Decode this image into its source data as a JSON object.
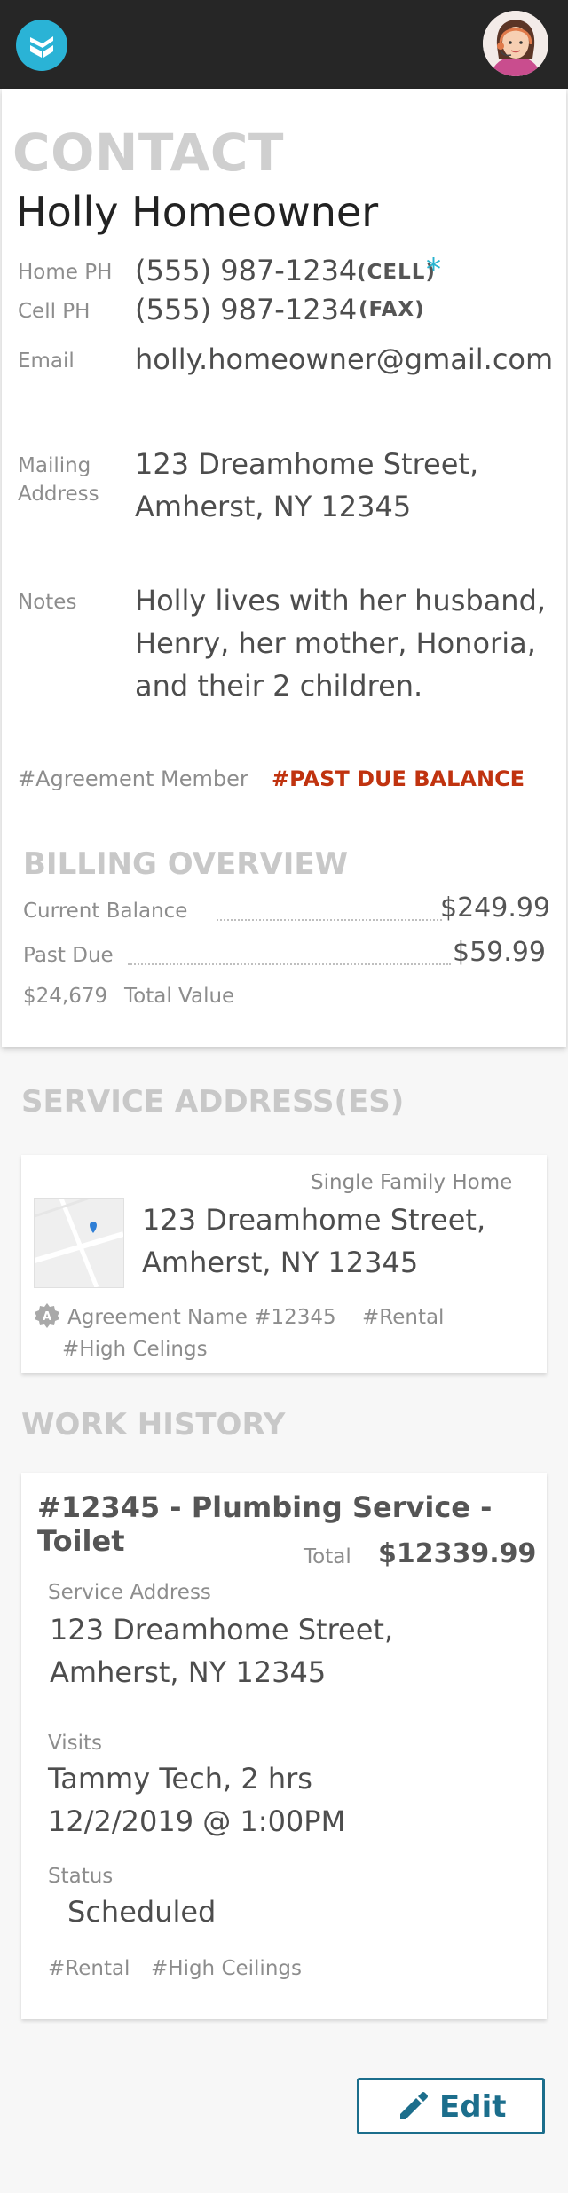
{
  "contact": {
    "heading": "CONTACT",
    "name": "Holly Homeowner",
    "phones": [
      {
        "label": "Home PH",
        "number": "(555) 987-1234",
        "tag": "(CELL)",
        "marker": "*"
      },
      {
        "label": "Cell PH",
        "number": "(555) 987-1234",
        "tag": "(FAX)"
      }
    ],
    "email_label": "Email",
    "email": "holly.homeowner@gmail.com",
    "mailing_label_1": "Mailing",
    "mailing_label_2": "Address",
    "mailing_line1": "123 Dreamhome Street,",
    "mailing_line2": "Amherst, NY 12345",
    "notes_label": "Notes",
    "notes_line1": "Holly lives with her husband,",
    "notes_line2": "Henry, her mother, Honoria,",
    "notes_line3": "and their 2 children.",
    "tags": [
      "#Agreement Member",
      "#PAST DUE BALANCE"
    ]
  },
  "billing": {
    "heading": "BILLING OVERVIEW",
    "current_label": "Current Balance",
    "current_value": "$249.99",
    "past_due_label": "Past Due",
    "past_due_value": "$59.99",
    "total_amount": "$24,679",
    "total_label": "Total Value"
  },
  "service": {
    "heading": "SERVICE ADDRESS(ES)",
    "type": "Single Family Home",
    "line1": "123 Dreamhome Street,",
    "line2": "Amherst, NY 12345",
    "agreement": "Agreement Name #12345",
    "tags": [
      "#Rental",
      "#High Celings"
    ]
  },
  "work": {
    "heading": "WORK HISTORY",
    "job_title": "#12345 - Plumbing Service - Toilet",
    "total_label": "Total",
    "total_value": "$12339.99",
    "service_address_label": "Service Address",
    "address_line1": "123 Dreamhome Street,",
    "address_line2": "Amherst, NY 12345",
    "visits_label": "Visits",
    "visit_tech": "Tammy Tech, 2 hrs",
    "visit_date": "12/2/2019 @ 1:00PM",
    "status_label": "Status",
    "status_value": "Scheduled",
    "tags": [
      "#Rental",
      "#High Ceilings"
    ]
  },
  "actions": {
    "edit_label": "Edit"
  },
  "colors": {
    "topbar": "#262626",
    "brand": "#2ab3d6",
    "accent": "#1c6e8c",
    "past_due": "#c0330f"
  },
  "icons": [
    "app-logo-icon",
    "user-avatar",
    "pin-icon",
    "agreement-badge-icon",
    "pencil-icon"
  ]
}
